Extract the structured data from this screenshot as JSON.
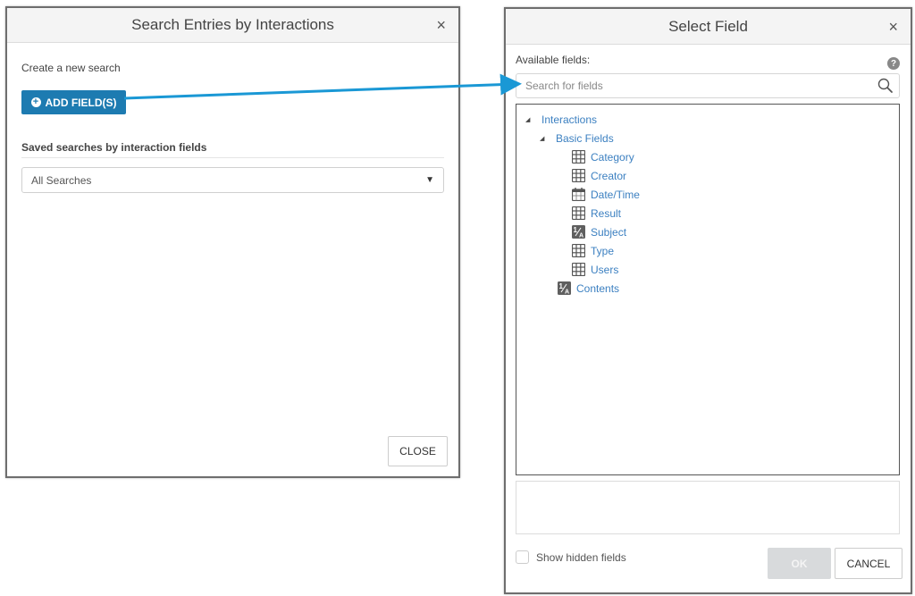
{
  "left_dialog": {
    "title": "Search Entries by Interactions",
    "close_glyph": "×",
    "create_label": "Create a new search",
    "add_button_label": "ADD FIELD(S)",
    "add_button_icon": "plus-circle-icon",
    "saved_label": "Saved searches by interaction fields",
    "saved_select_value": "All Searches",
    "close_button_label": "CLOSE"
  },
  "right_dialog": {
    "title": "Select Field",
    "close_glyph": "×",
    "available_label": "Available fields:",
    "help_glyph": "?",
    "search_placeholder": "Search for fields",
    "search_value": "",
    "tree": {
      "root": "Interactions",
      "group": "Basic Fields",
      "group_items": [
        {
          "label": "Category",
          "icon": "table-icon"
        },
        {
          "label": "Creator",
          "icon": "table-icon"
        },
        {
          "label": "Date/Time",
          "icon": "calendar-icon"
        },
        {
          "label": "Result",
          "icon": "table-icon"
        },
        {
          "label": "Subject",
          "icon": "text-field-icon"
        },
        {
          "label": "Type",
          "icon": "table-icon"
        },
        {
          "label": "Users",
          "icon": "table-icon"
        }
      ],
      "root_leaf": {
        "label": "Contents",
        "icon": "text-field-icon"
      }
    },
    "show_hidden_label": "Show hidden fields",
    "show_hidden_checked": false,
    "ok_label": "OK",
    "cancel_label": "CANCEL"
  },
  "colors": {
    "accent": "#1d7bb1",
    "link": "#3c80c1",
    "arrow": "#1a98d5"
  }
}
